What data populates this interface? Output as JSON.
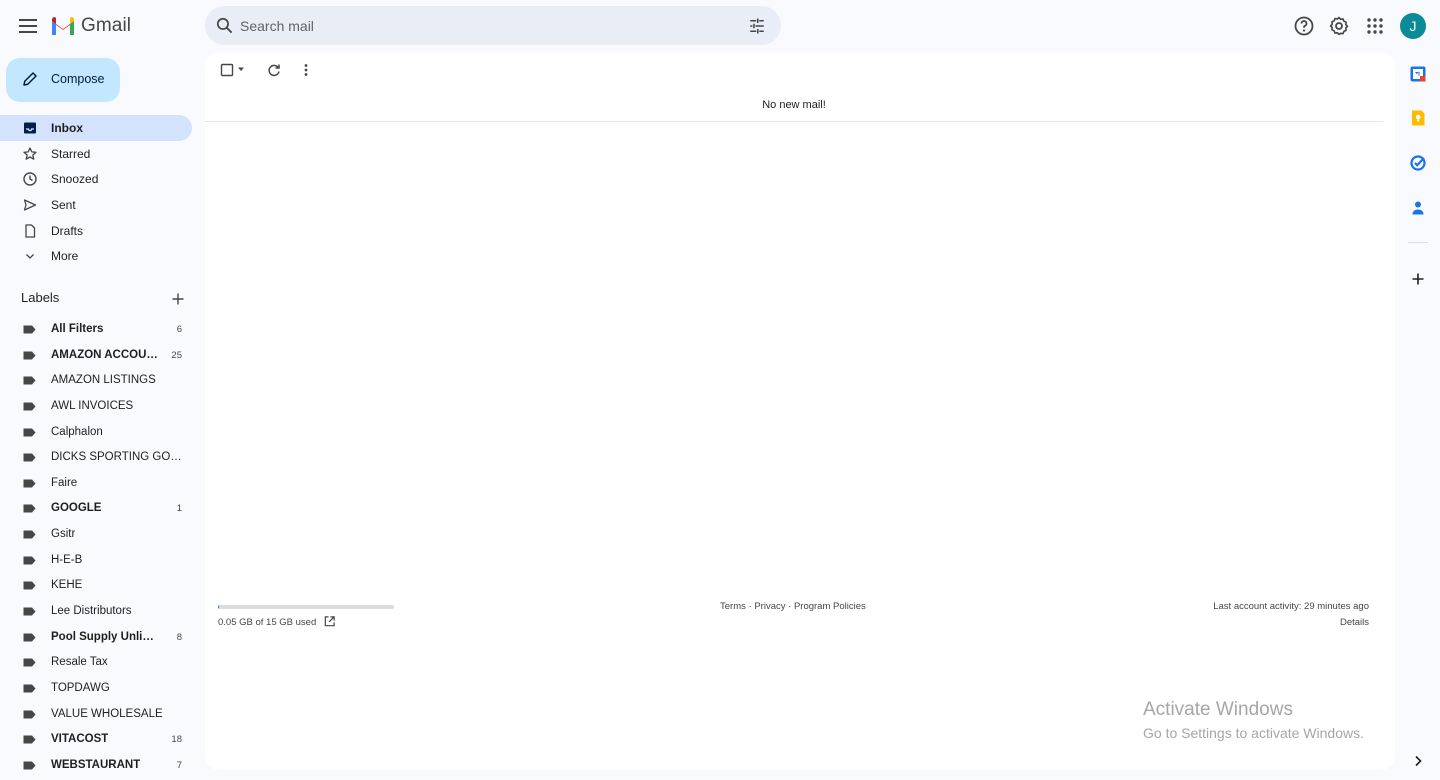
{
  "app": {
    "name": "Gmail"
  },
  "search": {
    "placeholder": "Search mail"
  },
  "account": {
    "initial": "J",
    "avatar_color": "#0b8a98"
  },
  "compose": {
    "label": "Compose"
  },
  "nav": [
    {
      "label": "Inbox",
      "icon": "inbox-icon",
      "active": true
    },
    {
      "label": "Starred",
      "icon": "star-icon"
    },
    {
      "label": "Snoozed",
      "icon": "clock-icon"
    },
    {
      "label": "Sent",
      "icon": "send-icon"
    },
    {
      "label": "Drafts",
      "icon": "draft-icon"
    },
    {
      "label": "More",
      "icon": "chevron-down-icon"
    }
  ],
  "labels_section": {
    "title": "Labels"
  },
  "labels": [
    {
      "name": "All Filters",
      "count": "6",
      "bold": true
    },
    {
      "name": "AMAZON ACCOUNT",
      "count": "25",
      "bold": true
    },
    {
      "name": "AMAZON LISTINGS",
      "count": "",
      "bold": false
    },
    {
      "name": "AWL INVOICES",
      "count": "",
      "bold": false
    },
    {
      "name": "Calphalon",
      "count": "",
      "bold": false
    },
    {
      "name": "DICKS SPORTING GOODS",
      "count": "",
      "bold": false
    },
    {
      "name": "Faire",
      "count": "",
      "bold": false
    },
    {
      "name": "GOOGLE",
      "count": "1",
      "bold": true
    },
    {
      "name": "Gsitr",
      "count": "",
      "bold": false
    },
    {
      "name": "H-E-B",
      "count": "",
      "bold": false
    },
    {
      "name": "KEHE",
      "count": "",
      "bold": false
    },
    {
      "name": "Lee Distributors",
      "count": "",
      "bold": false
    },
    {
      "name": "Pool Supply Unlimited",
      "count": "8",
      "bold": true
    },
    {
      "name": "Resale Tax",
      "count": "",
      "bold": false
    },
    {
      "name": "TOPDAWG",
      "count": "",
      "bold": false
    },
    {
      "name": "VALUE WHOLESALE",
      "count": "",
      "bold": false
    },
    {
      "name": "VITACOST",
      "count": "18",
      "bold": true
    },
    {
      "name": "WEBSTAURANT",
      "count": "7",
      "bold": true
    }
  ],
  "main": {
    "empty_message": "No new mail!",
    "storage": {
      "text": "0.05 GB of 15 GB used",
      "used_fraction": 0.0033
    },
    "footer": {
      "terms": "Terms",
      "privacy": "Privacy",
      "policies": "Program Policies",
      "separator": " · "
    },
    "activity": {
      "text": "Last account activity: 29 minutes ago",
      "details": "Details"
    }
  },
  "watermark": {
    "title": "Activate Windows",
    "subtitle": "Go to Settings to activate Windows."
  },
  "colors": {
    "accent": "#c2e7ff",
    "active_nav": "#d3e3fd",
    "background": "#f8fafd"
  }
}
